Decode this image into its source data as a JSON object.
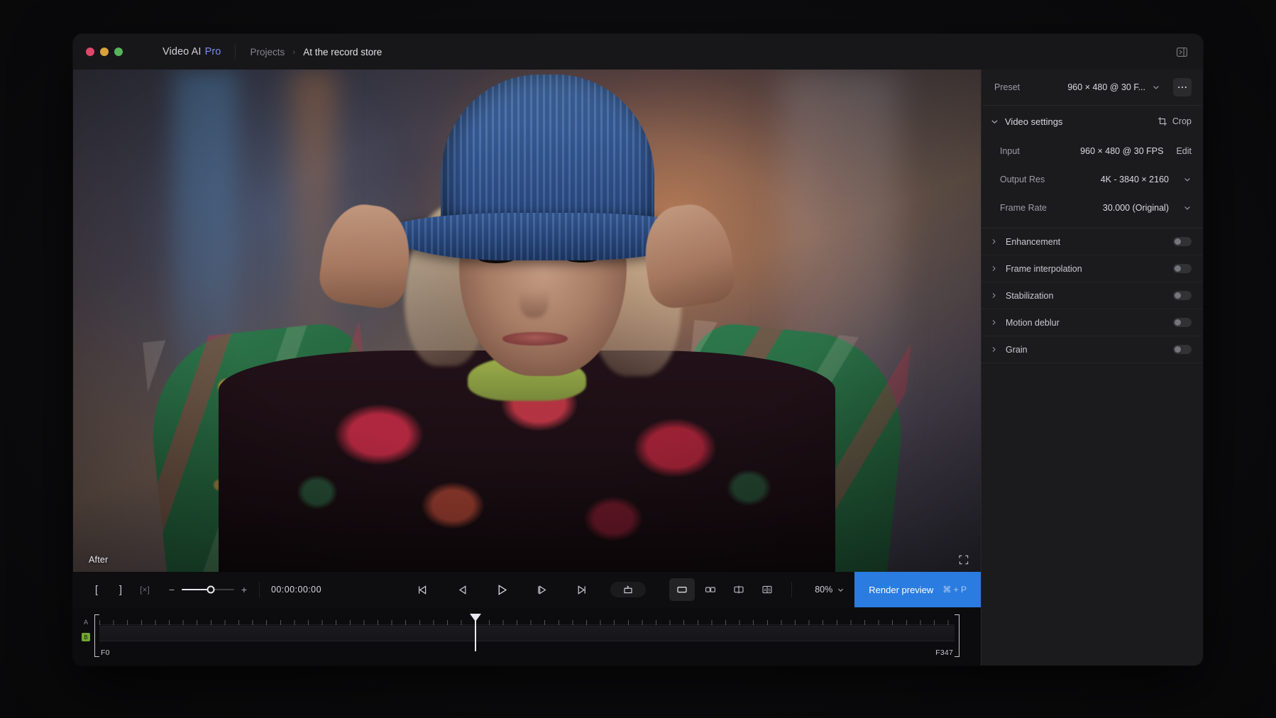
{
  "app": {
    "name_main": "Video AI",
    "name_accent": "Pro",
    "accent_color": "#7b8cf0"
  },
  "titlebar": {
    "breadcrumb": {
      "parent": "Projects",
      "separator": "›",
      "current": "At the record store"
    },
    "panel_toggle_icon": "panel-right-toggle-icon"
  },
  "viewer": {
    "overlay_label": "After",
    "fullscreen_icon": "fullscreen-expand-icon"
  },
  "transport": {
    "mark_in_label": "[",
    "mark_out_label": "]",
    "clear_marks_label": "[×]",
    "zoom_minus": "−",
    "zoom_plus": "+",
    "zoom_slider_value": 56,
    "timecode": "00:00:00:00",
    "buttons": [
      {
        "name": "skip-to-start-button",
        "icon": "skip-back-icon"
      },
      {
        "name": "step-back-button",
        "icon": "frame-back-icon"
      },
      {
        "name": "play-button",
        "icon": "play-icon"
      },
      {
        "name": "step-forward-button",
        "icon": "frame-forward-icon"
      },
      {
        "name": "skip-to-end-button",
        "icon": "skip-forward-icon"
      }
    ],
    "loop_icon": "loop-icon",
    "view_modes": [
      {
        "name": "single-view",
        "icon": "single-pane-icon",
        "active": true
      },
      {
        "name": "side-by-side-view",
        "icon": "two-pane-icon",
        "active": false
      },
      {
        "name": "split-view",
        "icon": "split-pane-icon",
        "active": false
      },
      {
        "name": "ab-compare-view",
        "icon": "ab-compare-icon",
        "active": false
      }
    ],
    "zoom_level": "80%",
    "render_label": "Render preview",
    "render_shortcut": "⌘ + P",
    "render_color": "#2a7ce0"
  },
  "timeline": {
    "track_a_label": "A",
    "track_b_label": "B",
    "track_b_color": "#74a52c",
    "frame_start": "F0",
    "frame_end": "F347",
    "playhead_percent": 44
  },
  "inspector": {
    "preset": {
      "label": "Preset",
      "value": "960 × 480 @ 30 F...",
      "more_icon": "ellipsis-icon"
    },
    "video_settings": {
      "title": "Video settings",
      "collapse_icon": "chevron-down-icon",
      "crop_label": "Crop",
      "crop_icon": "crop-icon",
      "fields": [
        {
          "label": "Input",
          "value": "960 × 480 @ 30 FPS",
          "action": "Edit",
          "control": "action"
        },
        {
          "label": "Output Res",
          "value": "4K - 3840 × 2160",
          "control": "dropdown"
        },
        {
          "label": "Frame Rate",
          "value": "30.000 (Original)",
          "control": "dropdown"
        }
      ]
    },
    "modules": [
      {
        "label": "Enhancement",
        "enabled": false
      },
      {
        "label": "Frame interpolation",
        "enabled": false
      },
      {
        "label": "Stabilization",
        "enabled": false
      },
      {
        "label": "Motion deblur",
        "enabled": false
      },
      {
        "label": "Grain",
        "enabled": false
      }
    ]
  }
}
